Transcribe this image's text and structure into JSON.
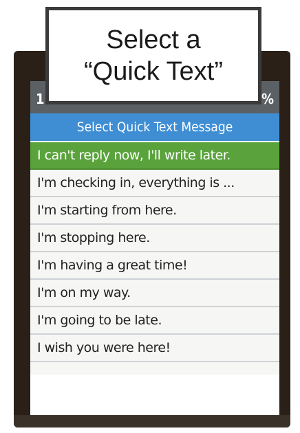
{
  "callout": {
    "line1": "Select a",
    "line2": "“Quick Text”"
  },
  "status_bar": {
    "left": "1",
    "right": "%"
  },
  "header": {
    "title": "Select Quick Text Message"
  },
  "messages": [
    "I can't reply now, I'll write later.",
    "I'm checking in, everything is ...",
    "I'm starting from here.",
    "I'm stopping here.",
    "I'm having a great time!",
    "I'm on my way.",
    "I'm going to be late.",
    "I wish you were here!"
  ],
  "selected_index": 0,
  "colors": {
    "header": "#3f8ed4",
    "selected": "#5aa33c",
    "callout_border": "#3b3b3b"
  }
}
